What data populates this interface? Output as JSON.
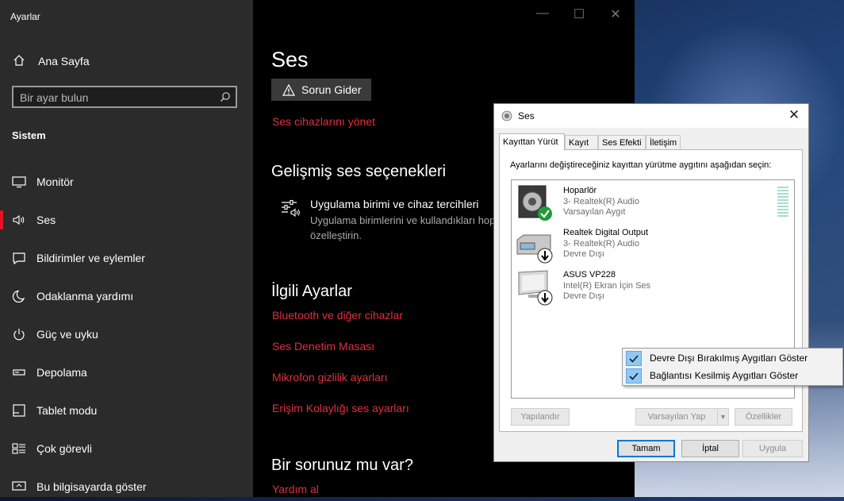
{
  "settings": {
    "app_title": "Ayarlar",
    "home_label": "Ana Sayfa",
    "search_placeholder": "Bir ayar bulun",
    "section_label": "Sistem",
    "nav": [
      {
        "label": "Monitör",
        "icon": "monitor-icon"
      },
      {
        "label": "Ses",
        "icon": "speaker-icon",
        "active": true
      },
      {
        "label": "Bildirimler ve eylemler",
        "icon": "notification-icon"
      },
      {
        "label": "Odaklanma yardımı",
        "icon": "moon-icon"
      },
      {
        "label": "Güç ve uyku",
        "icon": "power-icon"
      },
      {
        "label": "Depolama",
        "icon": "storage-icon"
      },
      {
        "label": "Tablet modu",
        "icon": "tablet-icon"
      },
      {
        "label": "Çok görevli",
        "icon": "multitask-icon"
      },
      {
        "label": "Bu bilgisayarda göster",
        "icon": "project-icon"
      }
    ],
    "page_title": "Ses",
    "troubleshoot_label": "Sorun Gider",
    "manage_devices_link": "Ses cihazlarını yönet",
    "advanced_heading": "Gelişmiş ses seçenekleri",
    "advanced_item_title": "Uygulama birimi ve cihaz tercihleri",
    "advanced_item_desc": "Uygulama birimlerini ve kullandıkları hop özelleştirin.",
    "related_heading": "İlgili Ayarlar",
    "related_links": [
      "Bluetooth ve diğer cihazlar",
      "Ses Denetim Masası",
      "Mikrofon gizlilik ayarları",
      "Erişim Kolaylığı ses ayarları"
    ],
    "question_heading": "Bir sorunuz mu var?",
    "help_link": "Yardım al",
    "accent_color": "#e81123"
  },
  "dialog": {
    "title": "Ses",
    "tabs": [
      "Kayıttan Yürüt",
      "Kayıt",
      "Ses Efekti",
      "İletişim"
    ],
    "instruction": "Ayarlarını değiştireceğiniz kayıttan yürütme aygıtını aşağıdan seçin:",
    "devices": [
      {
        "name": "Hoparlör",
        "line2": "3- Realtek(R) Audio",
        "line3": "Varsayılan Aygıt",
        "icon": "speaker-device-icon",
        "status": "default"
      },
      {
        "name": "Realtek Digital Output",
        "line2": "3- Realtek(R) Audio",
        "line3": "Devre Dışı",
        "icon": "digital-output-device-icon",
        "status": "disabled"
      },
      {
        "name": "ASUS VP228",
        "line2": "Intel(R) Ekran İçin Ses",
        "line3": "Devre Dışı",
        "icon": "monitor-device-icon",
        "status": "disabled"
      }
    ],
    "buttons": {
      "configure": "Yapılandır",
      "set_default": "Varsayılan Yap",
      "properties": "Özellikler",
      "ok": "Tamam",
      "cancel": "İptal",
      "apply": "Uygula"
    },
    "context_menu": [
      {
        "label": "Devre Dışı Bırakılmış Aygıtları Göster",
        "checked": true
      },
      {
        "label": "Bağlantısı Kesilmiş Aygıtları Göster",
        "checked": true
      }
    ]
  }
}
